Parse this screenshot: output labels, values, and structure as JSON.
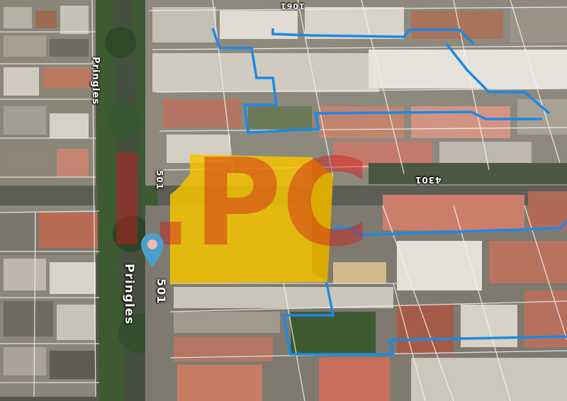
{
  "map": {
    "type": "satellite-3d",
    "street_labels": {
      "top_number": "1061",
      "pringles_upper": "Pringles",
      "side_number_left": "501",
      "cross_street_number": "4301",
      "pringles_lower": "Pringles",
      "lower_number": "501"
    },
    "watermark_text": "l.PC",
    "markers": [
      {
        "name": "location-pin",
        "icon": "map-pin-icon"
      }
    ],
    "colors": {
      "highlight": "#f5c400",
      "boundary": "#1e88e5",
      "watermark": "#d11b1b",
      "pin": "#4aa0c8"
    }
  }
}
